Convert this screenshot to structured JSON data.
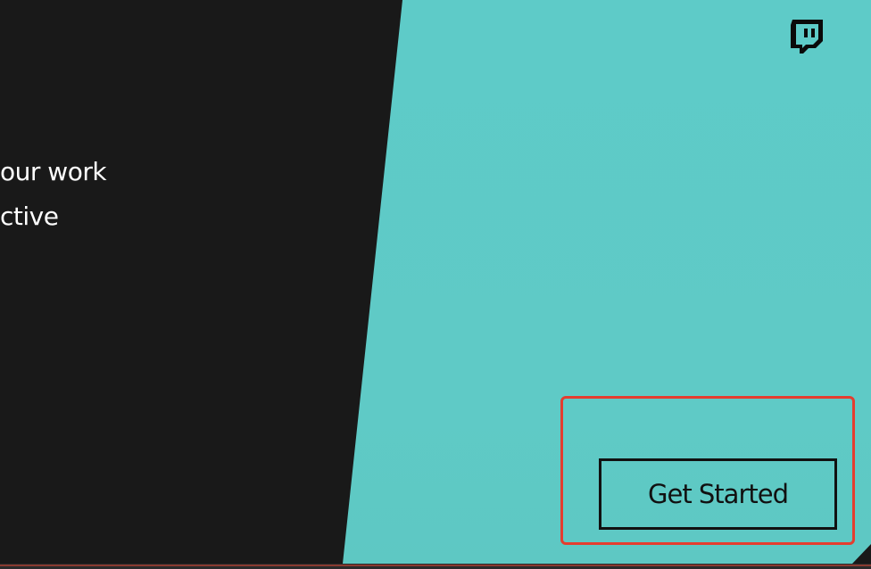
{
  "hero": {
    "lines": [
      "our work",
      "ctive"
    ]
  },
  "header": {
    "logo_icon": "twitch-icon"
  },
  "cta": {
    "label": "Get Started"
  },
  "colors": {
    "dark_panel": "#191919",
    "teal_panel": "#5ecbc8",
    "highlight": "#e43d2f",
    "button_border": "#111111"
  }
}
